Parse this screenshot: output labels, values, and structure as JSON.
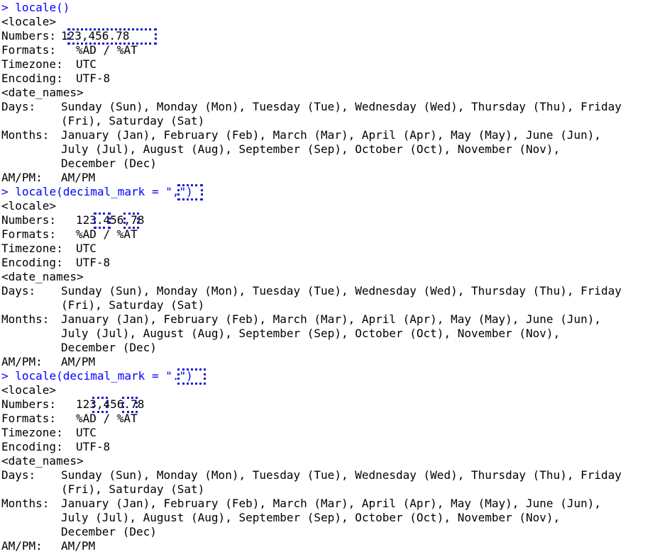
{
  "prompt_symbol": ">",
  "blocks": [
    {
      "command": "locale()",
      "header": "<locale>",
      "numbers_label": "Numbers:",
      "numbers_value": "123,456.78",
      "formats_label": "Formats:",
      "formats_value": "%AD / %AT",
      "timezone_label": "Timezone:",
      "timezone_value": "UTC",
      "encoding_label": "Encoding:",
      "encoding_value": "UTF-8",
      "date_names": "<date_names>",
      "days_label": "Days:",
      "days_line1": "Sunday (Sun), Monday (Mon), Tuesday (Tue), Wednesday (Wed), Thursday (Thu), Friday",
      "days_line2": "(Fri), Saturday (Sat)",
      "months_label": "Months:",
      "months_line1": "January (Jan), February (Feb), March (Mar), April (Apr), May (May), June (Jun),",
      "months_line2": "July (Jul), August (Aug), September (Sep), October (Oct), November (Nov),",
      "months_line3": "December (Dec)",
      "ampm_label": "AM/PM:",
      "ampm_value": "AM/PM"
    },
    {
      "command": "locale(decimal_mark = \",\")",
      "header": "<locale>",
      "numbers_label": "Numbers:",
      "numbers_value": "123.456,78",
      "formats_label": "Formats:",
      "formats_value": "%AD / %AT",
      "timezone_label": "Timezone:",
      "timezone_value": "UTC",
      "encoding_label": "Encoding:",
      "encoding_value": "UTF-8",
      "date_names": "<date_names>",
      "days_label": "Days:",
      "days_line1": "Sunday (Sun), Monday (Mon), Tuesday (Tue), Wednesday (Wed), Thursday (Thu), Friday",
      "days_line2": "(Fri), Saturday (Sat)",
      "months_label": "Months:",
      "months_line1": "January (Jan), February (Feb), March (Mar), April (Apr), May (May), June (Jun),",
      "months_line2": "July (Jul), August (Aug), September (Sep), October (Oct), November (Nov),",
      "months_line3": "December (Dec)",
      "ampm_label": "AM/PM:",
      "ampm_value": "AM/PM"
    },
    {
      "command": "locale(decimal_mark = \".\")",
      "header": "<locale>",
      "numbers_label": "Numbers:",
      "numbers_value": "123,456.78",
      "formats_label": "Formats:",
      "formats_value": "%AD / %AT",
      "timezone_label": "Timezone:",
      "timezone_value": "UTC",
      "encoding_label": "Encoding:",
      "encoding_value": "UTF-8",
      "date_names": "<date_names>",
      "days_label": "Days:",
      "days_line1": "Sunday (Sun), Monday (Mon), Tuesday (Tue), Wednesday (Wed), Thursday (Thu), Friday",
      "days_line2": "(Fri), Saturday (Sat)",
      "months_label": "Months:",
      "months_line1": "January (Jan), February (Feb), March (Mar), April (Apr), May (May), June (Jun),",
      "months_line2": "July (Jul), August (Aug), September (Sep), October (Oct), November (Nov),",
      "months_line3": "December (Dec)",
      "ampm_label": "AM/PM:",
      "ampm_value": "AM/PM"
    }
  ],
  "colors": {
    "command": "#0000ff",
    "output": "#000000",
    "highlight": "#1a1ad0"
  }
}
